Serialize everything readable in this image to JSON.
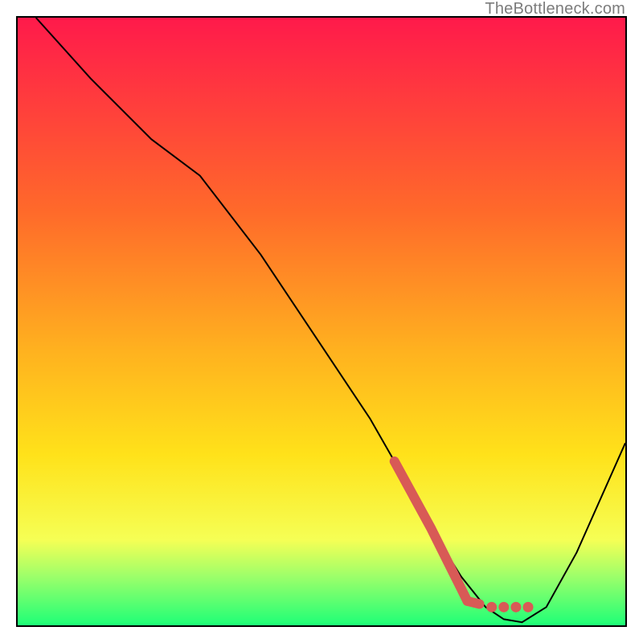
{
  "watermark": "TheBottleneck.com",
  "colors": {
    "gradient_top": "#ff1a4b",
    "gradient_mid1": "#ff6a2a",
    "gradient_mid2": "#ffb21f",
    "gradient_mid3": "#ffe21a",
    "gradient_band": "#f5ff55",
    "gradient_bot2": "#9cff6a",
    "gradient_bot": "#1eff77",
    "marker": "#d85a56"
  },
  "chart_data": {
    "type": "line",
    "title": "",
    "xlabel": "",
    "ylabel": "",
    "xlim": [
      0,
      100
    ],
    "ylim": [
      0,
      100
    ],
    "grid": false,
    "legend": false,
    "series": [
      {
        "name": "bottleneck-curve",
        "x": [
          3,
          12,
          22,
          30,
          40,
          50,
          58,
          62,
          68,
          73,
          77,
          80,
          83,
          87,
          92,
          100
        ],
        "y": [
          100,
          90,
          80,
          74,
          61,
          46,
          34,
          27,
          16,
          8,
          3,
          1,
          0.5,
          3,
          12,
          30
        ]
      }
    ],
    "highlight_segment": {
      "name": "marker-strip",
      "points": [
        {
          "x": 62,
          "y": 27
        },
        {
          "x": 68,
          "y": 16
        },
        {
          "x": 71,
          "y": 10
        },
        {
          "x": 73,
          "y": 6
        },
        {
          "x": 74,
          "y": 4
        },
        {
          "x": 76,
          "y": 3.5
        },
        {
          "x": 78,
          "y": 3
        },
        {
          "x": 80,
          "y": 3
        },
        {
          "x": 82,
          "y": 3
        }
      ],
      "dot_tail": [
        {
          "x": 78,
          "y": 3
        },
        {
          "x": 80,
          "y": 3
        },
        {
          "x": 82,
          "y": 3
        },
        {
          "x": 84,
          "y": 3
        }
      ]
    }
  }
}
